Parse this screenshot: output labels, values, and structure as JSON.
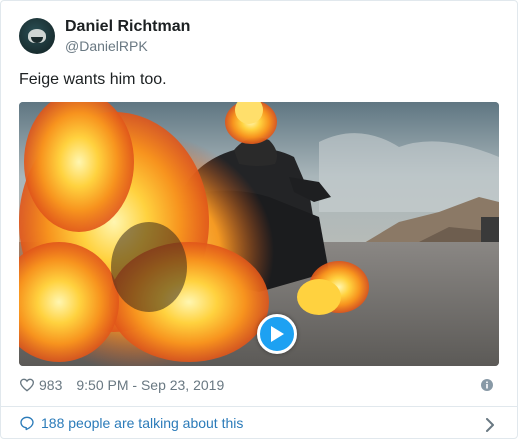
{
  "tweet": {
    "display_name": "Daniel Richtman",
    "handle": "@DanielRPK",
    "text": "Feige wants him too.",
    "likes": "983",
    "timestamp": "9:50 PM - Sep 23, 2019",
    "footer_text": "188 people are talking about this"
  },
  "icons": {
    "avatar": "avatar",
    "heart": "heart-icon",
    "info": "info-icon",
    "reply": "reply-icon",
    "play": "play-icon",
    "chevron": "chevron-right-icon"
  },
  "colors": {
    "accent": "#1da1f2",
    "link": "#2b7bb9",
    "muted": "#697882",
    "text": "#1c2022",
    "border": "#e1e8ed"
  }
}
